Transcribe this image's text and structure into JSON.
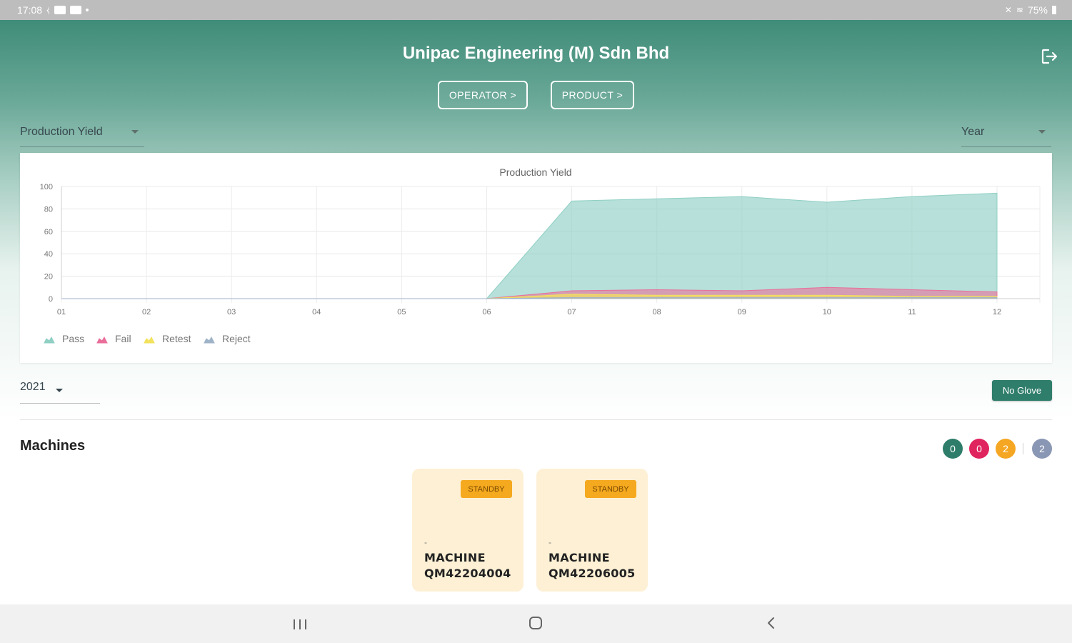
{
  "status_bar": {
    "time": "17:08",
    "battery": "75%"
  },
  "header": {
    "company": "Unipac Engineering (M) Sdn Bhd",
    "operator_button": "OPERATOR  >",
    "product_button": "PRODUCT  >",
    "logout_icon": "logout-icon"
  },
  "filters": {
    "metric_selected": "Production Yield",
    "period_selected": "Year",
    "year_selected": "2021",
    "no_glove_button": "No Glove"
  },
  "chart_data": {
    "type": "area",
    "title": "Production Yield",
    "x": [
      "01",
      "02",
      "03",
      "04",
      "05",
      "06",
      "07",
      "08",
      "09",
      "10",
      "11",
      "12"
    ],
    "ylim": [
      0,
      100
    ],
    "yticks": [
      0,
      20,
      40,
      60,
      80,
      100
    ],
    "grid": true,
    "legend_position": "bottom-left",
    "series": [
      {
        "name": "Pass",
        "color": "#8fcfc4",
        "values": [
          0,
          0,
          0,
          0,
          0,
          0,
          87,
          89,
          91,
          86,
          91,
          94
        ]
      },
      {
        "name": "Fail",
        "color": "#e96f9a",
        "values": [
          0,
          0,
          0,
          0,
          0,
          0,
          7,
          8,
          7,
          10,
          8,
          6
        ]
      },
      {
        "name": "Retest",
        "color": "#f2e25c",
        "values": [
          0,
          0,
          0,
          0,
          0,
          0,
          4,
          3,
          3,
          3,
          2,
          2
        ]
      },
      {
        "name": "Reject",
        "color": "#9fb3c8",
        "values": [
          0,
          0,
          0,
          0,
          0,
          0,
          1,
          1,
          1,
          1,
          1,
          1
        ]
      }
    ]
  },
  "machines": {
    "title": "Machines",
    "counts": [
      "0",
      "0",
      "2",
      "2"
    ],
    "items": [
      {
        "status": "STANDBY",
        "dash": "-",
        "name_line1": "MACHINE",
        "name_line2": "QM42204004"
      },
      {
        "status": "STANDBY",
        "dash": "-",
        "name_line1": "MACHINE",
        "name_line2": "QM42206005"
      }
    ]
  },
  "colors": {
    "brand": "#3f8c79",
    "standby": "#f5a91f",
    "card_bg": "#fdf0d5"
  }
}
